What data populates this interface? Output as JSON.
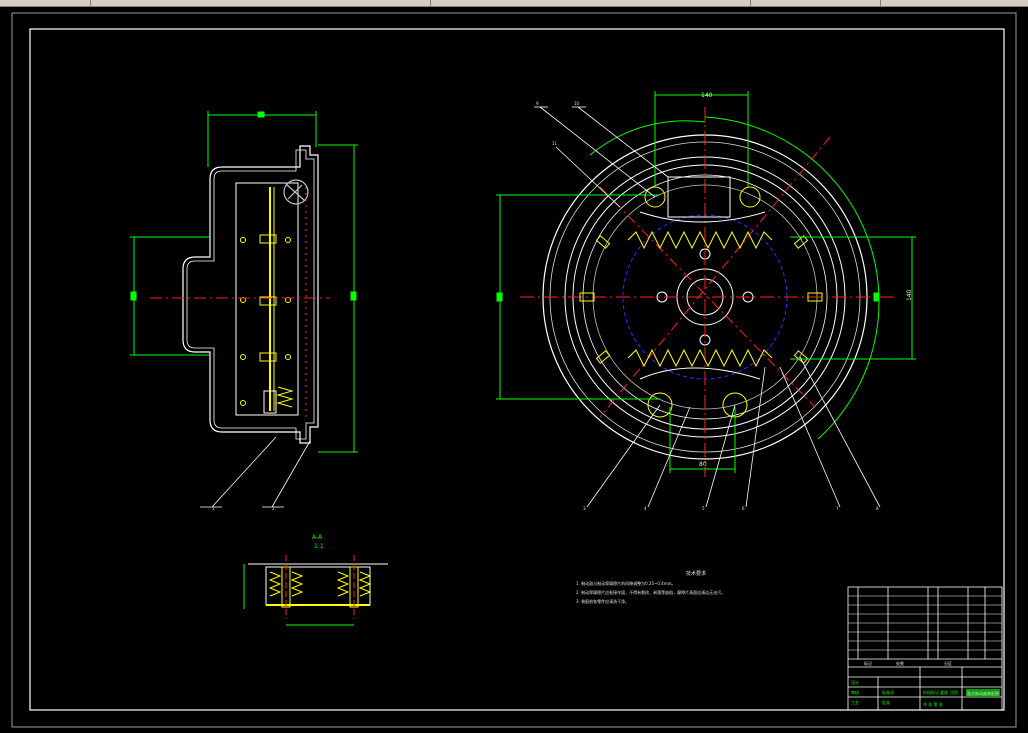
{
  "app": {
    "window": "AutoCAD drawing viewport"
  },
  "colors": {
    "background": "#000000",
    "border": "#ffffff",
    "geometry": "#ffffff",
    "dimension": "#00ff00",
    "center_line": "#ff2020",
    "spring": "#ffff00",
    "hidden": "#3030ff",
    "pipe": "#c0c0c0"
  },
  "drawing": {
    "top_dims": {
      "width_label": "140",
      "height_label": "140",
      "bottom_label": "80"
    },
    "section": {
      "name": "A-A",
      "scale": "1:1"
    },
    "notes_title": "技术要求",
    "notes": [
      "1. 制动鼓与制动蹄摩擦片的间隙调整为0.25~0.4mm。",
      "2. 制动蹄摩擦片应粘接牢固，不得有裂纹、剥落等缺陷，摩擦片表面应清洁无油污。",
      "3. 装配前各零件应清洗干净。"
    ],
    "leaders": [
      "1",
      "2",
      "3",
      "4",
      "5",
      "6",
      "7",
      "8",
      "9",
      "10",
      "11",
      "12"
    ],
    "title_block": {
      "cells": [
        "标记",
        "处数",
        "分区",
        "设计",
        "审核",
        "工艺",
        "批准",
        "标准化",
        "阶段标记",
        "重量",
        "比例",
        "共 张 第 张"
      ],
      "drawing_name": "鼓式制动器装配图"
    }
  }
}
